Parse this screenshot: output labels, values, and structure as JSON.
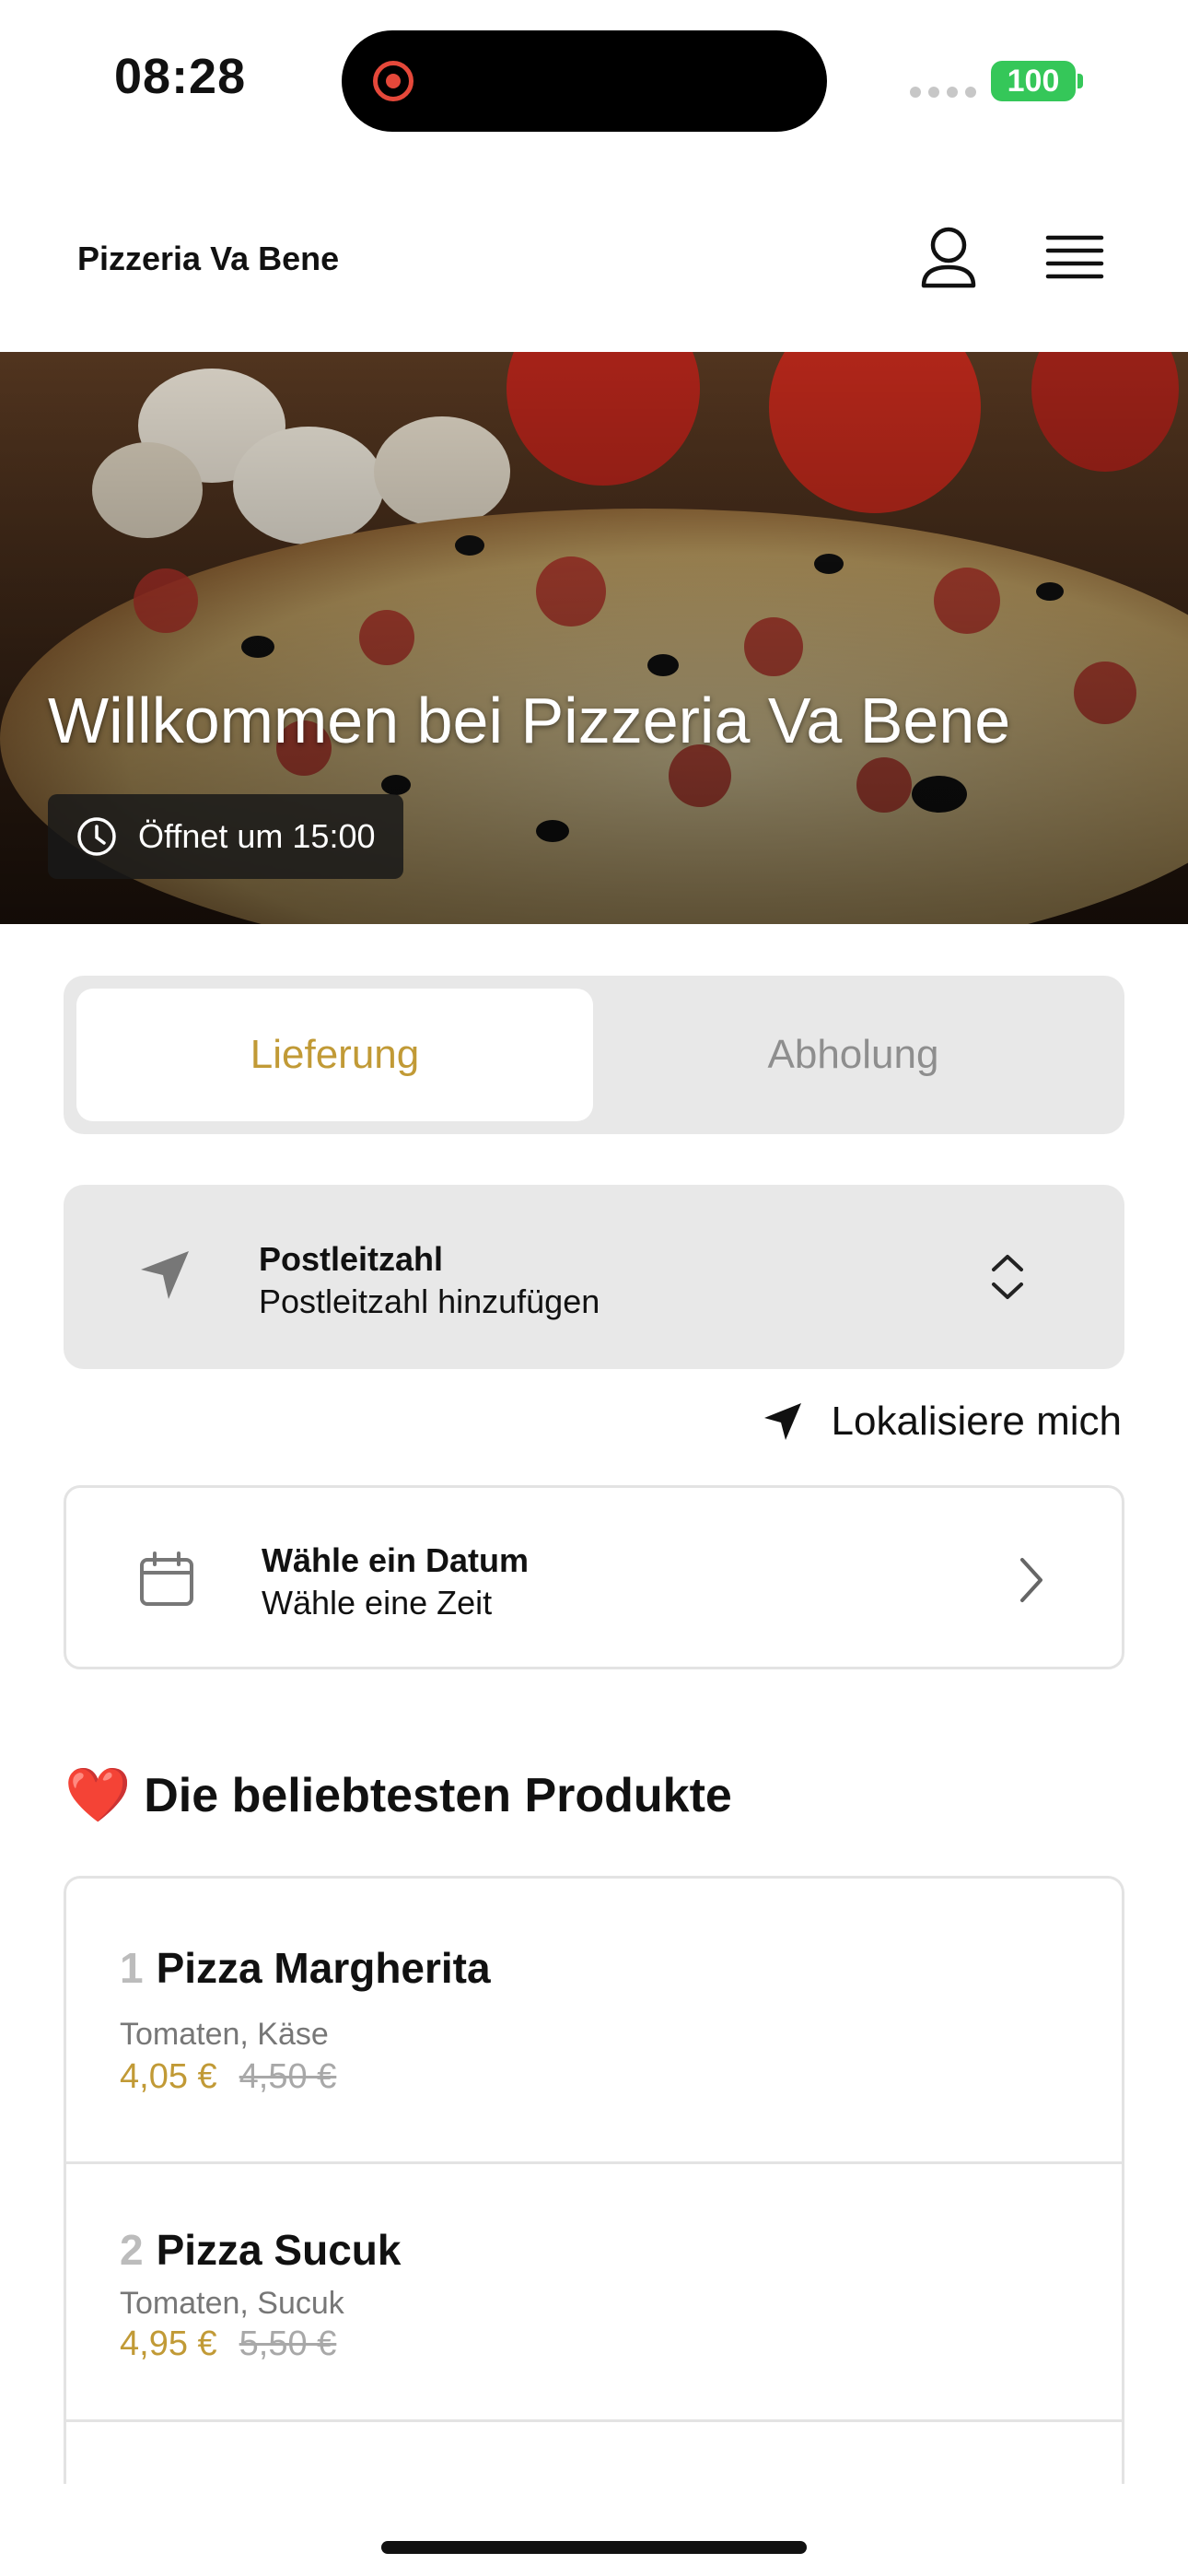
{
  "status_bar": {
    "time": "08:28",
    "battery": "100"
  },
  "header": {
    "brand": "Pizzeria Va Bene",
    "user_icon": "user-icon",
    "menu_icon": "hamburger-menu-icon"
  },
  "hero": {
    "title": "Willkommen bei Pizzeria Va Bene",
    "opening": "Öffnet um 15:00"
  },
  "mode_tabs": {
    "delivery": "Lieferung",
    "pickup": "Abholung",
    "selected": "delivery"
  },
  "postal": {
    "label": "Postleitzahl",
    "placeholder": "Postleitzahl hinzufügen"
  },
  "locate": {
    "label": "Lokalisiere mich"
  },
  "schedule": {
    "date_label": "Wähle ein Datum",
    "time_label": "Wähle eine Zeit"
  },
  "popular": {
    "emoji": "❤️",
    "title": "Die beliebtesten Produkte",
    "items": [
      {
        "rank": "1",
        "name": "Pizza Margherita",
        "description": "Tomaten, Käse",
        "price": "4,05 €",
        "old_price": "4,50 €"
      },
      {
        "rank": "2",
        "name": "Pizza Sucuk",
        "description": "Tomaten, Sucuk",
        "price": "4,95 €",
        "old_price": "5,50 €"
      }
    ]
  },
  "colors": {
    "accent": "#c19a36",
    "panel": "#e8e8e8",
    "battery": "#35c759",
    "record": "#e5483a"
  }
}
